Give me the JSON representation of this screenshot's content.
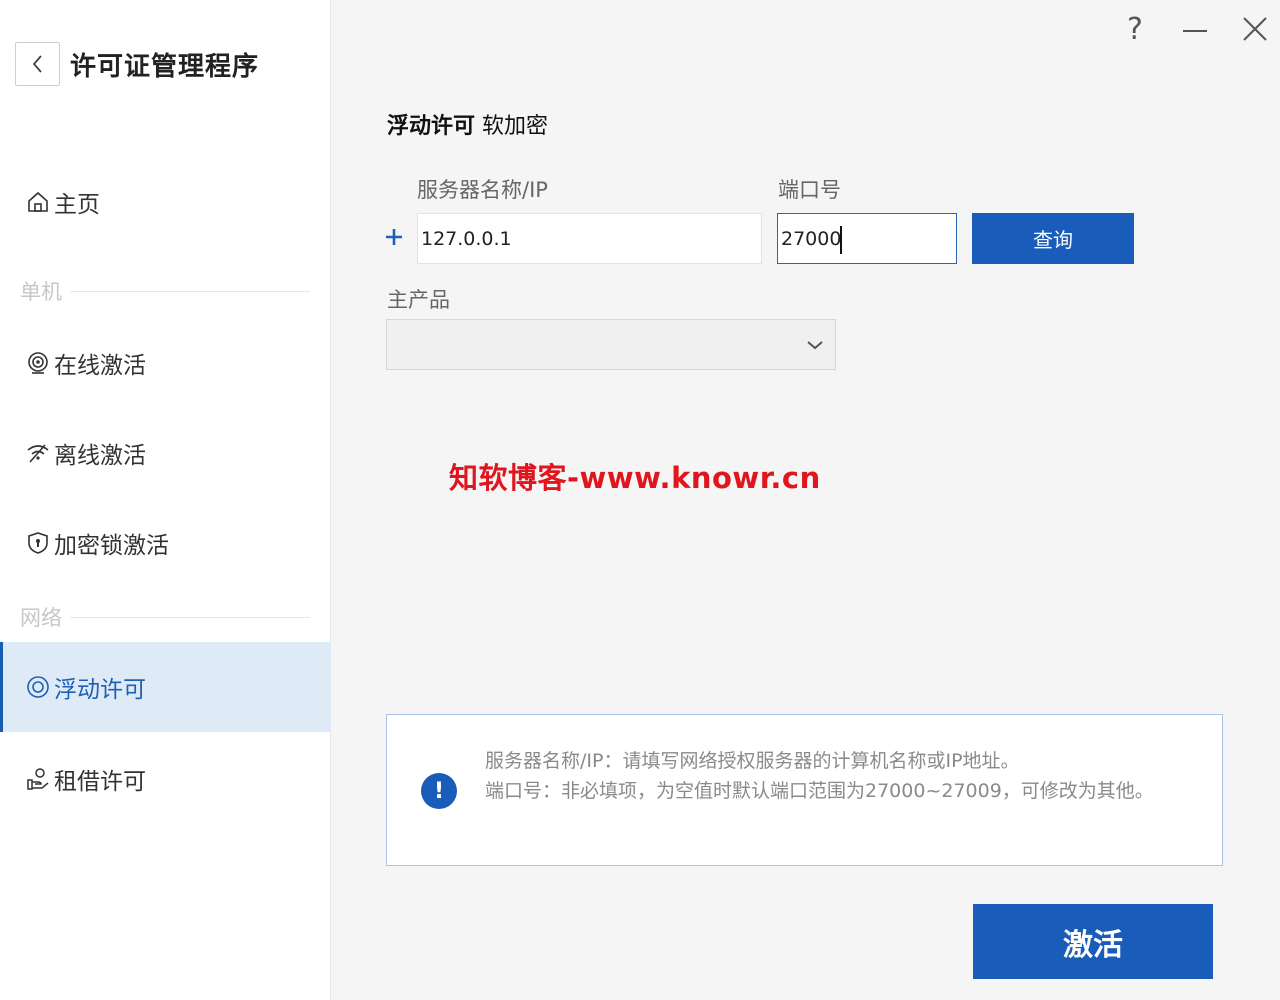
{
  "app": {
    "title": "许可证管理程序"
  },
  "nav": {
    "home": "主页",
    "section_standalone": "单机",
    "online": "在线激活",
    "offline": "离线激活",
    "dongle": "加密锁激活",
    "section_network": "网络",
    "floating": "浮动许可",
    "borrow": "租借许可"
  },
  "window_controls": {
    "help": "?",
    "minimize": "minimize-icon",
    "close": "close-icon"
  },
  "panel": {
    "title_bold": "浮动许可",
    "title_rest": " 软加密",
    "server_label": "服务器名称/IP",
    "port_label": "端口号",
    "server_value": "127.0.0.1",
    "port_value": "27000",
    "query_button": "查询",
    "product_label": "主产品",
    "product_value": ""
  },
  "watermark": "知软博客-www.knowr.cn",
  "info": {
    "line1": "服务器名称/IP：请填写网络授权服务器的计算机名称或IP地址。",
    "line2": "端口号：非必填项，为空值时默认端口范围为27000~27009，可修改为其他。"
  },
  "activate_button": "激活",
  "colors": {
    "accent": "#1a5cb9",
    "active_bg": "#deebf7",
    "watermark": "#e0161f"
  }
}
